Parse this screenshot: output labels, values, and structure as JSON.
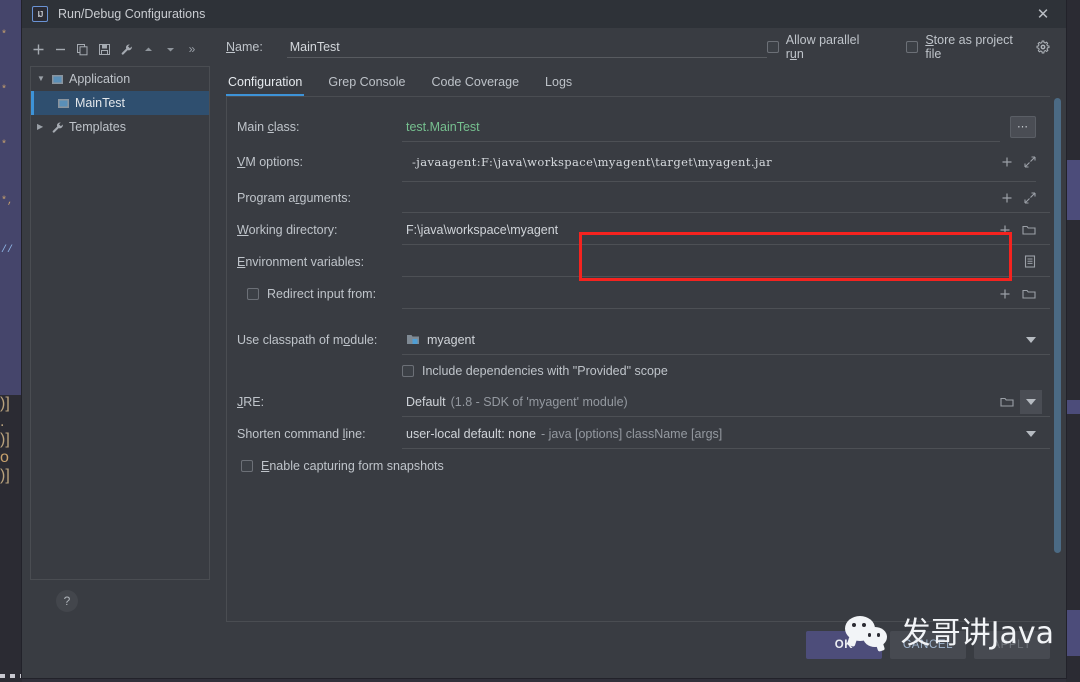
{
  "window": {
    "title": "Run/Debug Configurations",
    "app_icon": "intellij-idea-icon",
    "close_label": "✕"
  },
  "sidebar": {
    "toolbar": [
      {
        "name": "add-button",
        "glyph": "+"
      },
      {
        "name": "remove-button",
        "glyph": "−"
      },
      {
        "name": "copy-button",
        "glyph": "copy-icon"
      },
      {
        "name": "save-button",
        "glyph": "save-icon"
      },
      {
        "name": "edit-templates-button",
        "glyph": "wrench-icon"
      },
      {
        "name": "move-up-button",
        "glyph": "▲"
      },
      {
        "name": "move-down-button",
        "glyph": "▼"
      },
      {
        "name": "more-button",
        "glyph": "»"
      }
    ],
    "tree": [
      {
        "label": "Application",
        "icon": "application-icon",
        "expanded": true,
        "selected": false,
        "level": 0
      },
      {
        "label": "MainTest",
        "icon": "run-config-icon",
        "expanded": false,
        "selected": true,
        "level": 1
      },
      {
        "label": "Templates",
        "icon": "wrench-icon",
        "expanded": false,
        "selected": false,
        "level": 0
      }
    ],
    "help_label": "?"
  },
  "header": {
    "name_label": "Name:",
    "name_value": "MainTest",
    "allow_parallel_run": {
      "label": "Allow parallel run",
      "checked": false
    },
    "store_as_project_file": {
      "label": "Store as project file",
      "checked": false
    },
    "gear_icon": "gear-icon"
  },
  "tabs": [
    {
      "label": "Configuration",
      "active": true
    },
    {
      "label": "Grep Console",
      "active": false
    },
    {
      "label": "Code Coverage",
      "active": false
    },
    {
      "label": "Logs",
      "active": false
    }
  ],
  "form": {
    "main_class": {
      "label": "Main class:",
      "value": "test.MainTest",
      "browse_label": "…"
    },
    "vm_options": {
      "label": "VM options:",
      "value": "-javaagent:F:\\java\\workspace\\myagent\\target\\myagent.jar",
      "highlighted": true,
      "highlight_color": "#f5231f"
    },
    "program_arguments": {
      "label": "Program arguments:",
      "value": ""
    },
    "working_directory": {
      "label": "Working directory:",
      "value": "F:\\java\\workspace\\myagent"
    },
    "environment_variables": {
      "label": "Environment variables:",
      "value": ""
    },
    "redirect_input_from": {
      "label": "Redirect input from:",
      "checked": false,
      "value": ""
    },
    "use_classpath_of_module": {
      "label": "Use classpath of module:",
      "value": "myagent",
      "icon": "module-icon"
    },
    "include_provided_scope": {
      "label": "Include dependencies with \"Provided\" scope",
      "checked": false
    },
    "jre": {
      "label": "JRE:",
      "value": "Default",
      "value_detail": "(1.8 - SDK of 'myagent' module)"
    },
    "shorten_command_line": {
      "label": "Shorten command line:",
      "value": "user-local default: none",
      "value_detail": "- java [options] className [args]"
    },
    "enable_form_snapshots": {
      "label": "Enable capturing form snapshots",
      "checked": false
    }
  },
  "footer": {
    "ok_label": "OK",
    "cancel_label": "CANCEL",
    "apply_label": "APPLY"
  },
  "watermark": {
    "text": "发哥讲Java",
    "logo": "wechat-icon"
  },
  "colors": {
    "accent": "#3d93d8",
    "highlight": "#f5231f",
    "selection": "#2f4f6f",
    "value_green": "#76c08f",
    "dialog_bg": "#393c42",
    "titlebar_bg": "#2e3238"
  }
}
